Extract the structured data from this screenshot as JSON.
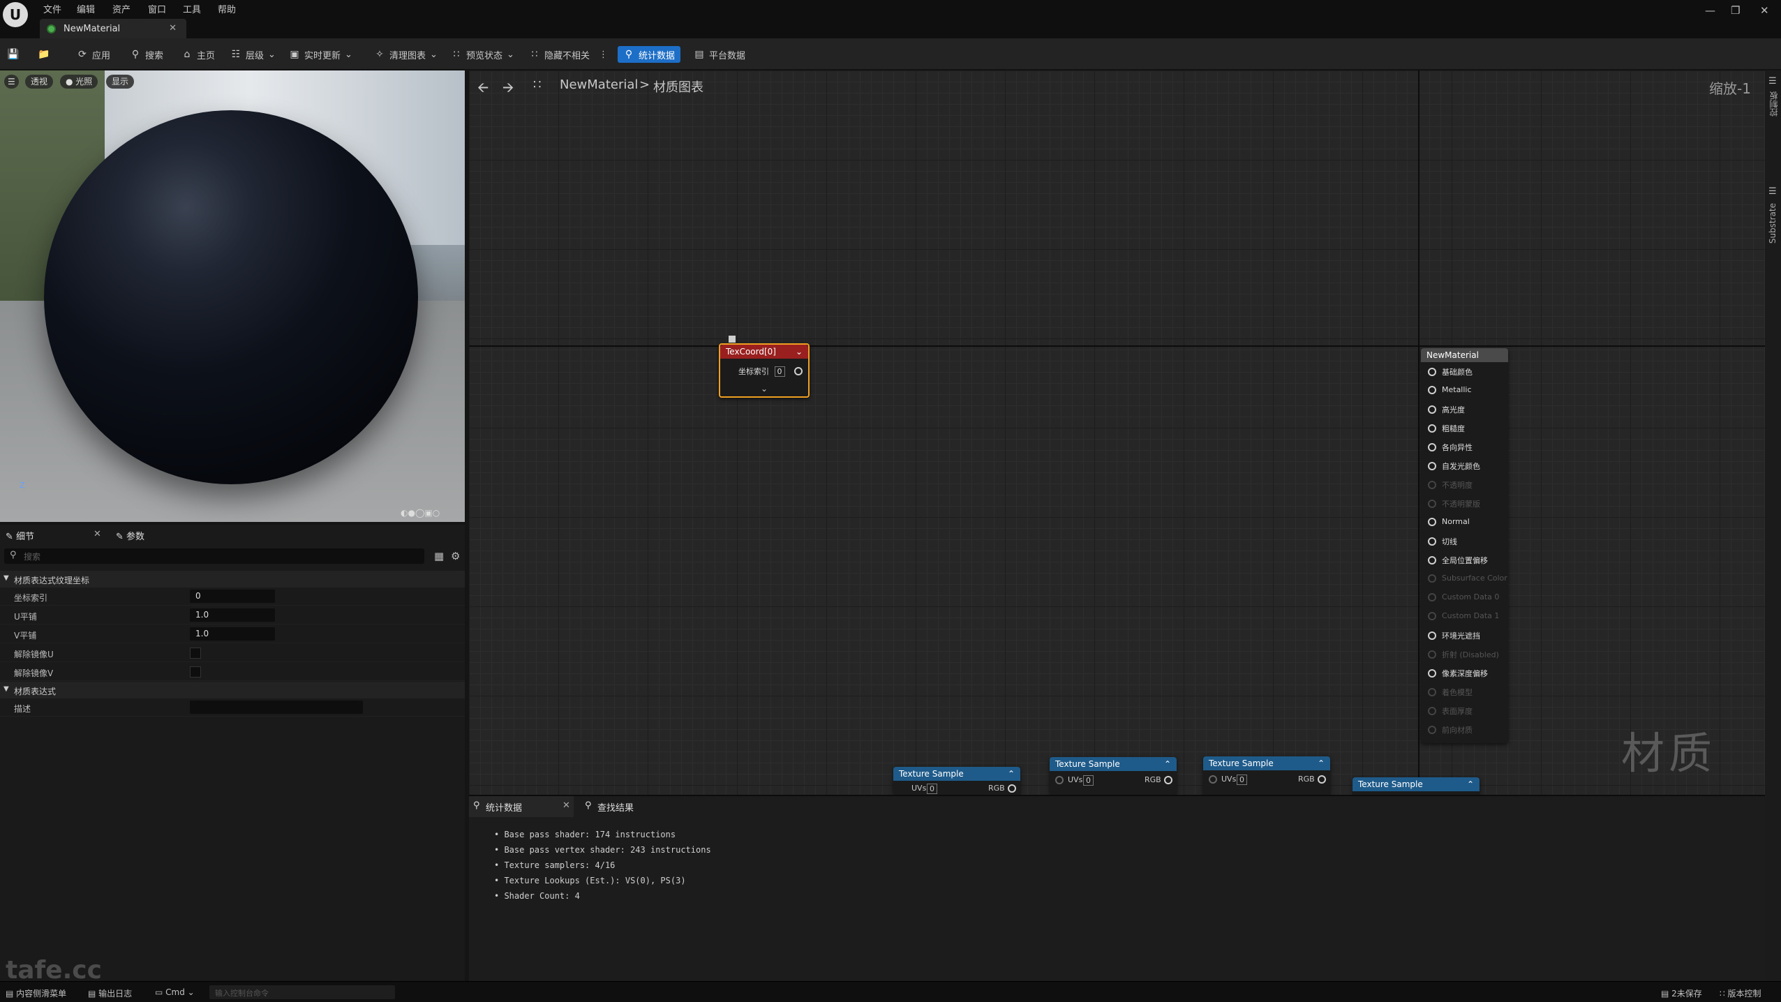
{
  "menu": [
    "文件",
    "编辑",
    "资产",
    "窗口",
    "工具",
    "帮助"
  ],
  "tab": {
    "label": "NewMaterial"
  },
  "toolbar": {
    "apply": "应用",
    "search": "搜索",
    "home": "主页",
    "hierarchy": "层级",
    "live_update": "实时更新",
    "clean_graph": "清理图表",
    "preview_state": "预览状态",
    "hide_unrelated": "隐藏不相关",
    "stats": "统计数据",
    "platform_stats": "平台数据"
  },
  "viewport": {
    "perspective": "透视",
    "lit": "光照",
    "show": "显示",
    "axis_label": "Z"
  },
  "details": {
    "tab_details": "细节",
    "tab_params": "参数",
    "search_placeholder": "搜索",
    "section1": "材质表达式纹理坐标",
    "rows": [
      {
        "label": "坐标索引",
        "value": "0"
      },
      {
        "label": "U平铺",
        "value": "1.0"
      },
      {
        "label": "V平铺",
        "value": "1.0"
      },
      {
        "label": "解除镜像U",
        "value": ""
      },
      {
        "label": "解除镜像V",
        "value": ""
      }
    ],
    "section2": "材质表达式",
    "desc_label": "描述"
  },
  "graph": {
    "breadcrumb_root": "NewMaterial",
    "breadcrumb_sep": ">",
    "breadcrumb_leaf": "材质图表",
    "zoom": "缩放-1",
    "watermark": "材质",
    "texcoord": {
      "title": "TexCoord[0]",
      "row_label": "坐标索引",
      "row_value": "0"
    },
    "texture_sample_title": "Texture Sample",
    "uvs_label": "UVs",
    "uvs_value": "0",
    "rgb_label": "RGB",
    "result": {
      "title": "NewMaterial",
      "pins": [
        {
          "label": "基础颜色",
          "active": true
        },
        {
          "label": "Metallic",
          "active": true
        },
        {
          "label": "高光度",
          "active": true
        },
        {
          "label": "粗糙度",
          "active": true
        },
        {
          "label": "各向异性",
          "active": true
        },
        {
          "label": "自发光颜色",
          "active": true
        },
        {
          "label": "不透明度",
          "active": false
        },
        {
          "label": "不透明蒙版",
          "active": false
        },
        {
          "label": "Normal",
          "active": true
        },
        {
          "label": "切线",
          "active": true
        },
        {
          "label": "全局位置偏移",
          "active": true
        },
        {
          "label": "Subsurface Color",
          "active": false
        },
        {
          "label": "Custom Data 0",
          "active": false
        },
        {
          "label": "Custom Data 1",
          "active": false
        },
        {
          "label": "环境光遮挡",
          "active": true
        },
        {
          "label": "折射 (Disabled)",
          "active": false
        },
        {
          "label": "像素深度偏移",
          "active": true
        },
        {
          "label": "着色模型",
          "active": false
        },
        {
          "label": "表面厚度",
          "active": false
        },
        {
          "label": "前向材质",
          "active": false
        }
      ]
    }
  },
  "rail": {
    "details": "控制板",
    "substrate": "Substrate"
  },
  "stats": {
    "tab_stats": "统计数据",
    "tab_find": "查找结果",
    "lines": [
      "Base pass shader: 174 instructions",
      "Base pass vertex shader: 243 instructions",
      "Texture samplers: 4/16",
      "Texture Lookups (Est.): VS(0), PS(3)",
      "Shader Count: 4"
    ]
  },
  "statusbar": {
    "content_drawer": "内容侧滑菜单",
    "output_log": "输出日志",
    "cmd": "Cmd",
    "cmd_placeholder": "输入控制台命令",
    "unsaved": "2未保存",
    "source_control": "版本控制"
  },
  "watermark_logo": "tafe.cc"
}
